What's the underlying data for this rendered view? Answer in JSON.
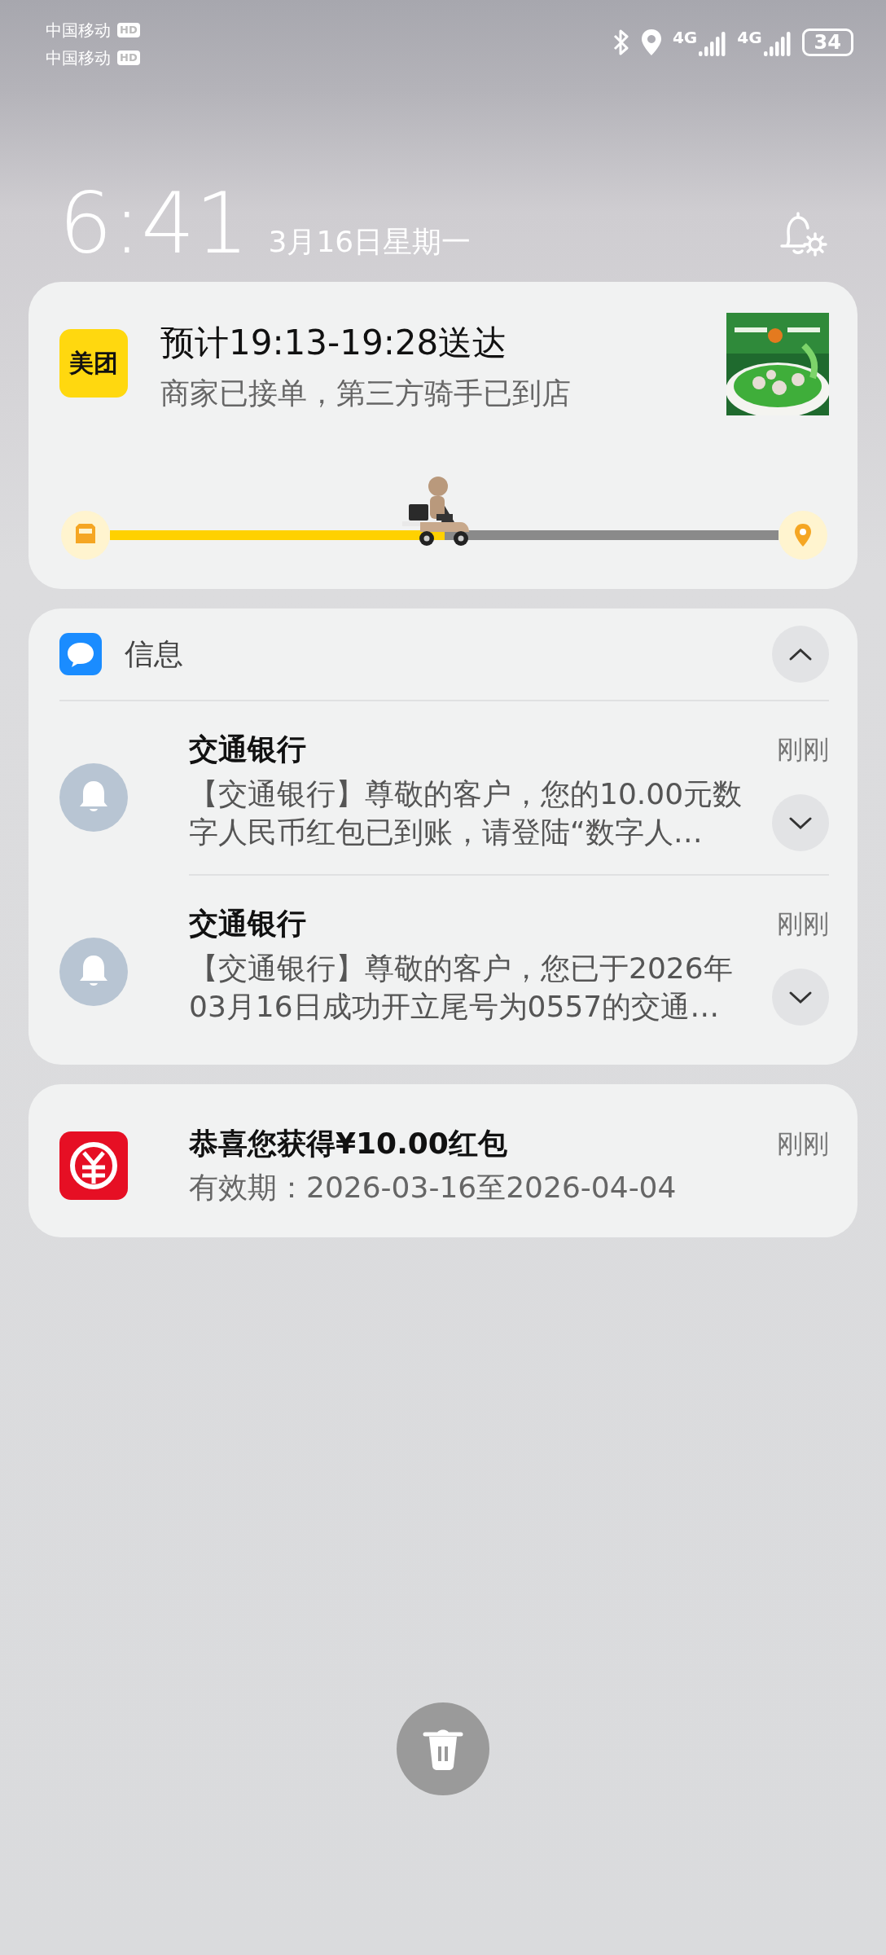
{
  "status_bar": {
    "carriers": [
      {
        "name": "中国移动",
        "badge": "HD"
      },
      {
        "name": "中国移动",
        "badge": "HD"
      }
    ],
    "signals": [
      {
        "label": "4G"
      },
      {
        "label": "4G"
      }
    ],
    "battery": "34"
  },
  "header": {
    "time": "6:41",
    "date": "3月16日星期一"
  },
  "delivery_card": {
    "app_logo": "美团",
    "title": "预计19:13-19:28送达",
    "subtitle": "商家已接单，第三方骑手已到店",
    "progress": {
      "level": 0.5
    }
  },
  "message_group": {
    "app_name": "信息",
    "expanded": true,
    "messages": [
      {
        "sender": "交通银行",
        "time": "刚刚",
        "body_lines": [
          "【交通银行】尊敬的客户，您的10.00元数",
          "字人民币红包已到账，请登陆“数字人…"
        ],
        "expanded": false
      },
      {
        "sender": "交通银行",
        "time": "刚刚",
        "body_lines": [
          "【交通银行】尊敬的客户，您已于2026年",
          "03月16日成功开立尾号为0557的交通…"
        ],
        "expanded": false
      }
    ]
  },
  "red_packet_card": {
    "title": "恭喜您获得¥10.00红包",
    "subtitle": "有效期：2026-03-16至2026-04-04",
    "time": "刚刚"
  }
}
